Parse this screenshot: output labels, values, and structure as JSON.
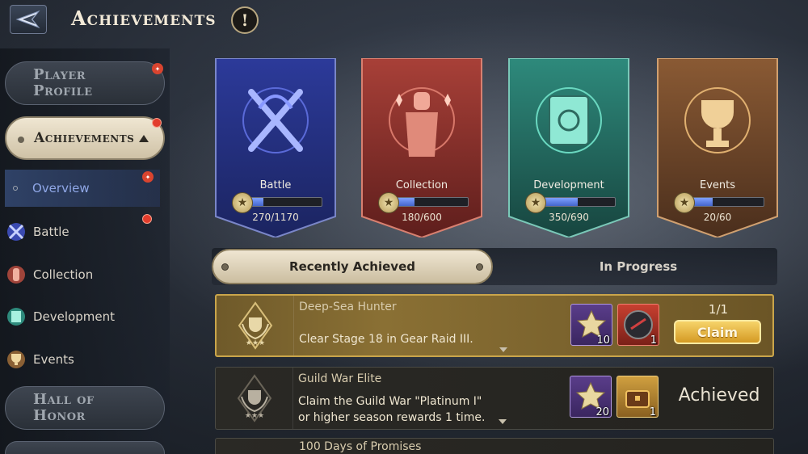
{
  "header": {
    "title": "Achievements",
    "info_symbol": "!"
  },
  "sidebar": {
    "player_profile": "Player Profile",
    "achievements": "Achievements",
    "overview": "Overview",
    "categories": [
      {
        "label": "Battle",
        "icon": "battle-icon"
      },
      {
        "label": "Collection",
        "icon": "collection-icon"
      },
      {
        "label": "Development",
        "icon": "development-icon"
      },
      {
        "label": "Events",
        "icon": "events-icon"
      }
    ],
    "hall_of_honor": "Hall of Honor"
  },
  "banners": [
    {
      "name": "Battle",
      "count": "270/1170",
      "progress": 0.23,
      "color": "#3a4aa0"
    },
    {
      "name": "Collection",
      "count": "180/600",
      "progress": 0.3,
      "color": "#9a3a34"
    },
    {
      "name": "Development",
      "count": "350/690",
      "progress": 0.51,
      "color": "#2e7a70"
    },
    {
      "name": "Events",
      "count": "20/60",
      "progress": 0.33,
      "color": "#8a5a34"
    }
  ],
  "tabs": {
    "recent": "Recently Achieved",
    "in_progress": "In Progress"
  },
  "achievements": [
    {
      "title": "Deep-Sea Hunter",
      "desc_line1": "Clear Stage 18 in Gear Raid III.",
      "desc_line2": "",
      "rewards": [
        {
          "qty": "10"
        },
        {
          "qty": "1"
        }
      ],
      "progress": "1/1",
      "action": "Claim"
    },
    {
      "title": "Guild War Elite",
      "desc_line1": "Claim the Guild War \"Platinum I\"",
      "desc_line2": "or higher season rewards 1 time.",
      "rewards": [
        {
          "qty": "20"
        },
        {
          "qty": "1"
        }
      ],
      "status": "Achieved"
    },
    {
      "title": "100 Days of Promises"
    }
  ]
}
